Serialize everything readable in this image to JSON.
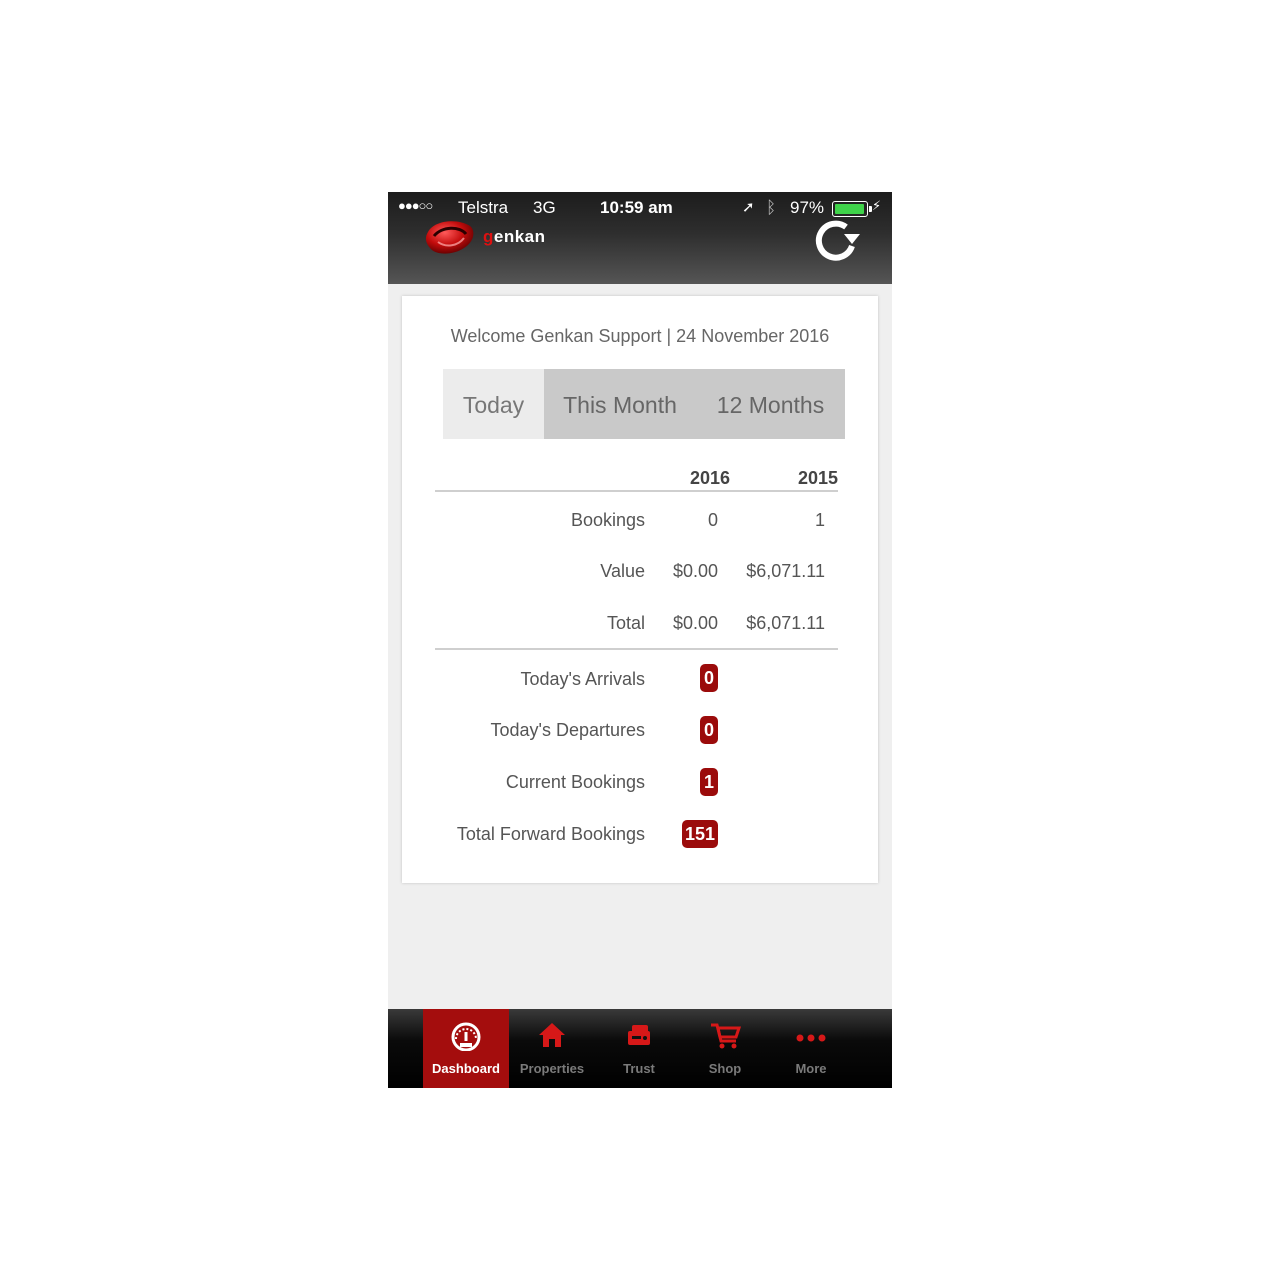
{
  "status_bar": {
    "carrier": "Telstra",
    "network": "3G",
    "time": "10:59 am",
    "battery_percent": "97%",
    "battery_level": 0.97,
    "battery_color": "#3fd34a",
    "signal_dots": "●●●○○",
    "location_icon": "location-arrow-icon",
    "bluetooth_icon": "bluetooth-icon",
    "charging_icon": "charging-bolt-icon"
  },
  "header": {
    "brand_first_letter": "g",
    "brand_rest": "enkan",
    "refresh_icon": "refresh-icon"
  },
  "colors": {
    "accent": "#9b0b0b",
    "tab_active": "#a40d0d",
    "brand_red": "#d11111"
  },
  "card": {
    "welcome": "Welcome Genkan Support | 24 November 2016",
    "tabs": [
      {
        "label": "Today",
        "selected": true
      },
      {
        "label": "This Month",
        "selected": false
      },
      {
        "label": "12 Months",
        "selected": false
      }
    ],
    "columns": [
      "2016",
      "2015"
    ],
    "rows": [
      {
        "label": "Bookings",
        "v2016": "0",
        "v2015": "1"
      },
      {
        "label": "Value",
        "v2016": "$0.00",
        "v2015": "$6,071.11"
      },
      {
        "label": "Total",
        "v2016": "$0.00",
        "v2015": "$6,071.11"
      }
    ],
    "stats": [
      {
        "label": "Today's Arrivals",
        "count": "0"
      },
      {
        "label": "Today's Departures",
        "count": "0"
      },
      {
        "label": "Current Bookings",
        "count": "1"
      },
      {
        "label": "Total Forward Bookings",
        "count": "151"
      }
    ]
  },
  "tab_bar": [
    {
      "label": "Dashboard",
      "icon": "speedometer-icon",
      "active": true
    },
    {
      "label": "Properties",
      "icon": "house-icon",
      "active": false
    },
    {
      "label": "Trust",
      "icon": "wallet-icon",
      "active": false
    },
    {
      "label": "Shop",
      "icon": "shopping-cart-icon",
      "active": false
    },
    {
      "label": "More",
      "icon": "more-dots-icon",
      "active": false
    }
  ]
}
